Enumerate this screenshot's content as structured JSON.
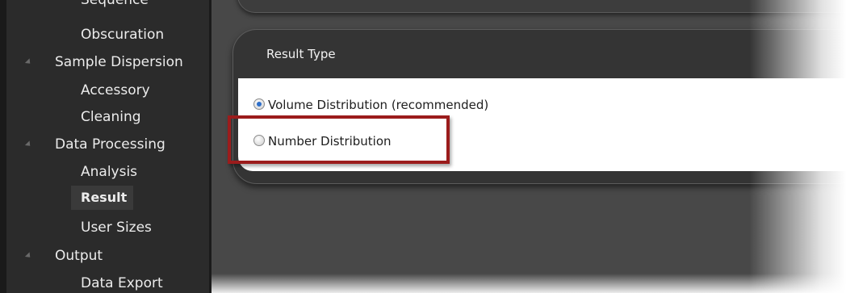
{
  "sidebar": {
    "items": [
      {
        "label": "Sequence"
      },
      {
        "label": "Obscuration"
      },
      {
        "label": "Sample Dispersion"
      },
      {
        "label": "Accessory"
      },
      {
        "label": "Cleaning"
      },
      {
        "label": "Data Processing"
      },
      {
        "label": "Analysis"
      },
      {
        "label": "Result"
      },
      {
        "label": "User Sizes"
      },
      {
        "label": "Output"
      },
      {
        "label": "Data Export"
      }
    ]
  },
  "result_type": {
    "title": "Result Type",
    "options": [
      {
        "label": "Volume Distribution (recommended)",
        "selected": true
      },
      {
        "label": "Number Distribution",
        "selected": false
      }
    ]
  },
  "colors": {
    "highlight_border": "#9b1c1c",
    "sidebar_bg": "#2b2b2b",
    "content_bg": "#484848",
    "radio_selected": "#2f6fc9"
  },
  "icons": {
    "tree_expand": "expand-arrow-icon"
  }
}
